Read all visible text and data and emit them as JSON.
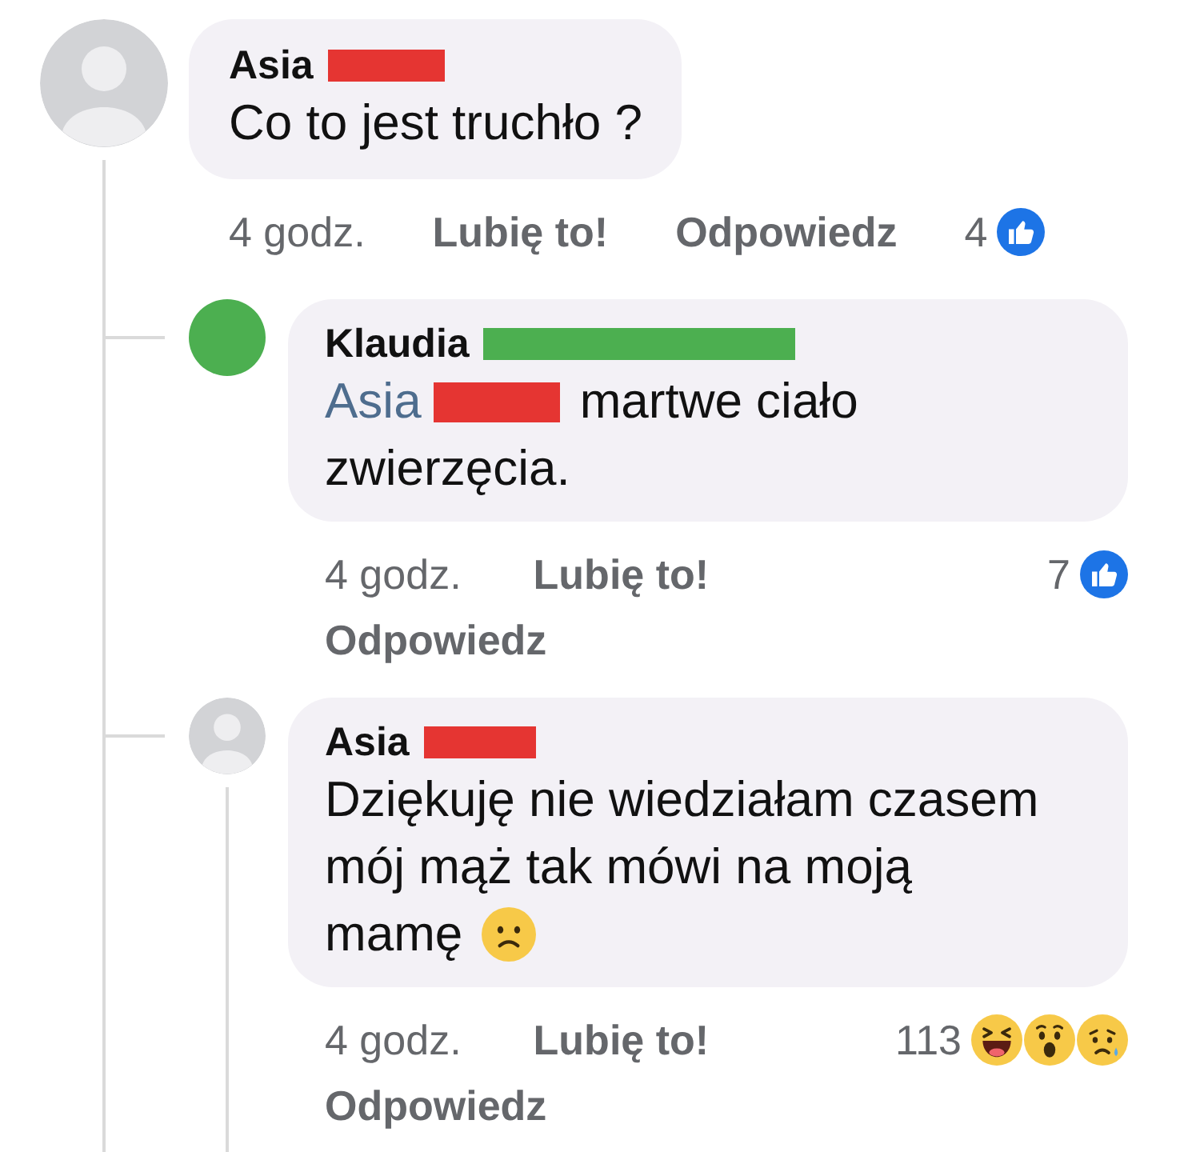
{
  "comments": [
    {
      "avatar": {
        "kind": "silhouette"
      },
      "author": "Asia",
      "redaction": {
        "color": "#e53532"
      },
      "body": [
        {
          "kind": "text",
          "text": "Co to jest truchło ?"
        }
      ],
      "time": "4 godz.",
      "like": "Lubię to!",
      "reply": "Odpowiedz",
      "reaction_count": "4",
      "reactions": [
        {
          "kind": "like"
        }
      ],
      "replies": [
        {
          "avatar": {
            "kind": "solid",
            "color": "#4caf50"
          },
          "author": "Klaudia",
          "redaction": {
            "color": "#4caf50"
          },
          "body": [
            {
              "kind": "mention",
              "text": "Asia"
            },
            {
              "kind": "redaction",
              "color": "#e53532"
            },
            {
              "kind": "text",
              "text": "martwe ciało\nzwierzęcia."
            }
          ],
          "time": "4 godz.",
          "like": "Lubię to!",
          "reply": "Odpowiedz",
          "reaction_count": "7",
          "reactions": [
            {
              "kind": "like"
            }
          ],
          "thread_line": false
        },
        {
          "avatar": {
            "kind": "silhouette"
          },
          "author": "Asia",
          "redaction": {
            "color": "#e53532"
          },
          "body": [
            {
              "kind": "text",
              "text": "Dziękuję nie wiedziałam czasem\nmój mąż tak mówi na moją\nmamę"
            },
            {
              "kind": "frown"
            }
          ],
          "time": "4 godz.",
          "like": "Lubię to!",
          "reply": "Odpowiedz",
          "reaction_count": "113",
          "reactions": [
            {
              "kind": "haha"
            },
            {
              "kind": "wow"
            },
            {
              "kind": "sad"
            }
          ],
          "thread_line": true
        }
      ]
    }
  ]
}
